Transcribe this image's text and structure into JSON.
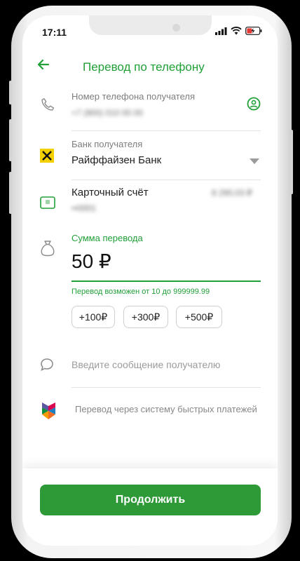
{
  "status": {
    "time": "17:11"
  },
  "header": {
    "title": "Перевод по телефону"
  },
  "phone_field": {
    "label": "Номер телефона получателя",
    "value": "+7 (900) 010 00 00"
  },
  "bank_field": {
    "label": "Банк получателя",
    "value": "Райффайзен Банк"
  },
  "account": {
    "label": "Карточный счёт",
    "number": "••0001",
    "balance": "8 290,03 ₽"
  },
  "amount": {
    "label": "Сумма перевода",
    "value": "50 ₽",
    "hint": "Перевод возможен от 10 до 999999.99",
    "chips": [
      "+100₽",
      "+300₽",
      "+500₽"
    ]
  },
  "message": {
    "placeholder": "Введите сообщение получателю"
  },
  "sbp": {
    "text": "Перевод через систему быстрых платежей"
  },
  "footer": {
    "continue_label": "Продолжить"
  },
  "colors": {
    "accent": "#21a038",
    "button": "#2e9a37"
  }
}
